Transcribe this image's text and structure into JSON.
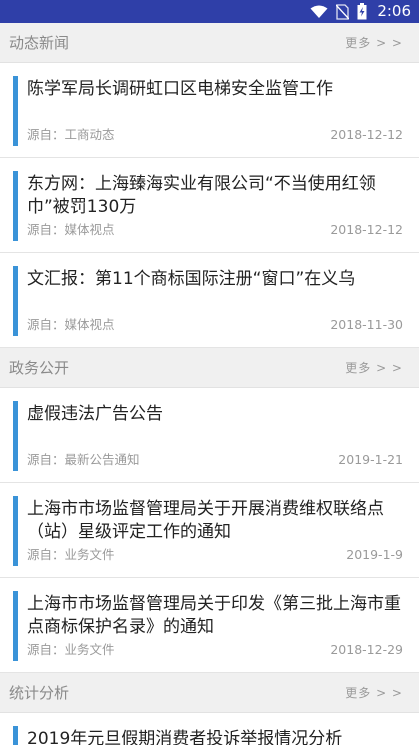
{
  "status": {
    "time": "2:06"
  },
  "sections": [
    {
      "title": "动态新闻",
      "more": "更多 > >",
      "items": [
        {
          "headline": "陈学军局长调研虹口区电梯安全监管工作",
          "source": "源自：工商动态",
          "date": "2018-12-12"
        },
        {
          "headline": "东方网：上海臻海实业有限公司“不当使用红领巾”被罚130万",
          "source": "源自：媒体视点",
          "date": "2018-12-12"
        },
        {
          "headline": "文汇报：第11个商标国际注册“窗口”在义乌",
          "source": "源自：媒体视点",
          "date": "2018-11-30"
        }
      ]
    },
    {
      "title": "政务公开",
      "more": "更多 > >",
      "items": [
        {
          "headline": "虚假违法广告公告",
          "source": "源自：最新公告通知",
          "date": "2019-1-21"
        },
        {
          "headline": "上海市市场监督管理局关于开展消费维权联络点（站）星级评定工作的通知",
          "source": "源自：业务文件",
          "date": "2019-1-9"
        },
        {
          "headline": "上海市市场监督管理局关于印发《第三批上海市重点商标保护名录》的通知",
          "source": "源自：业务文件",
          "date": "2018-12-29"
        }
      ]
    },
    {
      "title": "统计分析",
      "more": "更多 > >",
      "items": [
        {
          "headline": "2019年元旦假期消费者投诉举报情况分析"
        }
      ]
    }
  ]
}
